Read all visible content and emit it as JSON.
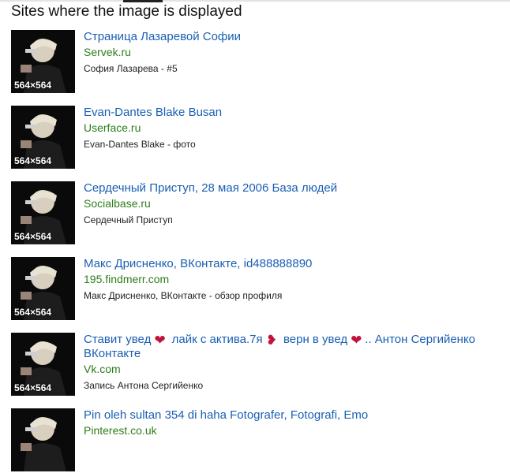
{
  "heading": "Sites where the image is displayed",
  "thumb_size": "564×564",
  "results": [
    {
      "title": "Страница Лазаревой Софии",
      "site": "Servek.ru",
      "desc": "София Лазарева - #5"
    },
    {
      "title": "Evan-Dantes Blake Busan",
      "site": "Userface.ru",
      "desc": "Evan-Dantes Blake - фото"
    },
    {
      "title": "Сердечный Приступ, 28 мая 2006 База людей",
      "site": "Socialbase.ru",
      "desc": "Сердечный Приступ"
    },
    {
      "title": "Макс Дрисненко, ВКонтакте, id488888890",
      "site": "195.findmerr.com",
      "desc": "Макс Дрисненко, ВКонтакте - обзор профиля"
    },
    {
      "title_parts": [
        "Ставит увед ",
        " лайк с актива.7я ",
        " верн в увед ",
        ".. Антон Сергийенко ВКонтакте"
      ],
      "site": "Vk.com",
      "desc": "Запись Антона Сергийенко"
    },
    {
      "title": "Pin oleh sultan 354 di haha Fotografer, Fotografi, Emo",
      "site": "Pinterest.co.uk",
      "desc": ""
    }
  ],
  "icons": {
    "heart": "red-heart-icon",
    "broken_heart": "broken-heart-icon"
  },
  "colors": {
    "link": "#1a5fb4",
    "site": "#2e7d1a"
  }
}
